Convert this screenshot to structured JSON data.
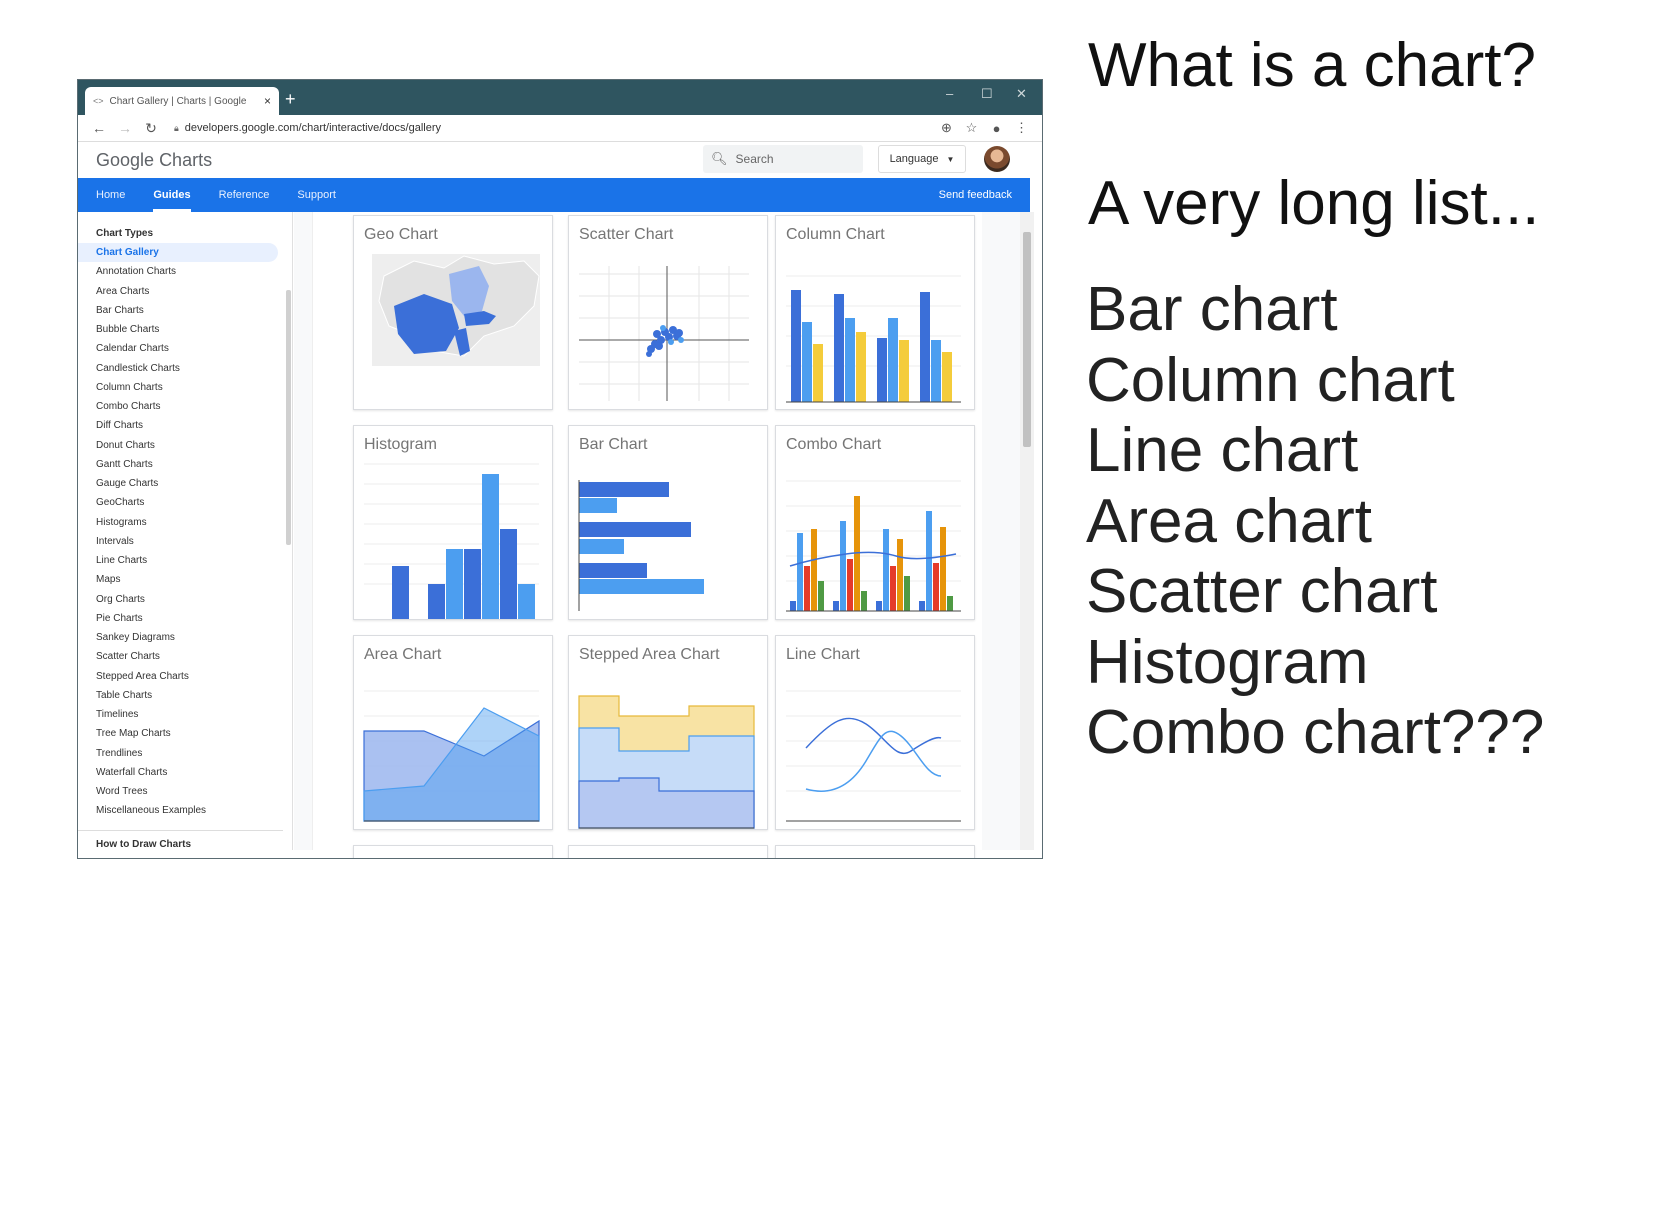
{
  "browser": {
    "tab_favicon": "<>",
    "tab_title": "Chart Gallery | Charts | Google",
    "tab_close": "×",
    "new_tab": "+",
    "window_controls": {
      "minimize": "–",
      "maximize": "☐",
      "close": "✕"
    },
    "url": "developers.google.com/chart/interactive/docs/gallery"
  },
  "header": {
    "logo_google": "Google",
    "logo_charts": "Charts",
    "search_placeholder": "Search",
    "language_label": "Language"
  },
  "nav": {
    "items": [
      "Home",
      "Guides",
      "Reference",
      "Support"
    ],
    "active": "Guides",
    "feedback": "Send feedback"
  },
  "sidebar": {
    "heading": "Chart Types",
    "items": [
      "Chart Gallery",
      "Annotation Charts",
      "Area Charts",
      "Bar Charts",
      "Bubble Charts",
      "Calendar Charts",
      "Candlestick Charts",
      "Column Charts",
      "Combo Charts",
      "Diff Charts",
      "Donut Charts",
      "Gantt Charts",
      "Gauge Charts",
      "GeoCharts",
      "Histograms",
      "Intervals",
      "Line Charts",
      "Maps",
      "Org Charts",
      "Pie Charts",
      "Sankey Diagrams",
      "Scatter Charts",
      "Stepped Area Charts",
      "Table Charts",
      "Timelines",
      "Tree Map Charts",
      "Trendlines",
      "Waterfall Charts",
      "Word Trees",
      "Miscellaneous Examples"
    ],
    "active": "Chart Gallery",
    "footer_heading": "How to Draw Charts"
  },
  "gallery": {
    "cards": [
      "Geo Chart",
      "Scatter Chart",
      "Column Chart",
      "Histogram",
      "Bar Chart",
      "Combo Chart",
      "Area Chart",
      "Stepped Area Chart",
      "Line Chart"
    ]
  },
  "colors": {
    "blue_dark": "#3b6fd8",
    "blue_mid": "#4c9ef0",
    "yellow": "#f4cc3b",
    "orange": "#e6940a",
    "red": "#e53b2a",
    "green": "#4f9a44",
    "nav_blue": "#1a73e8"
  },
  "slide": {
    "title": "What is a chart?",
    "subtitle": "A very long list...",
    "list": [
      "Bar chart",
      "Column chart",
      "Line chart",
      "Area chart",
      "Scatter chart",
      "Histogram",
      "Combo chart???"
    ]
  }
}
